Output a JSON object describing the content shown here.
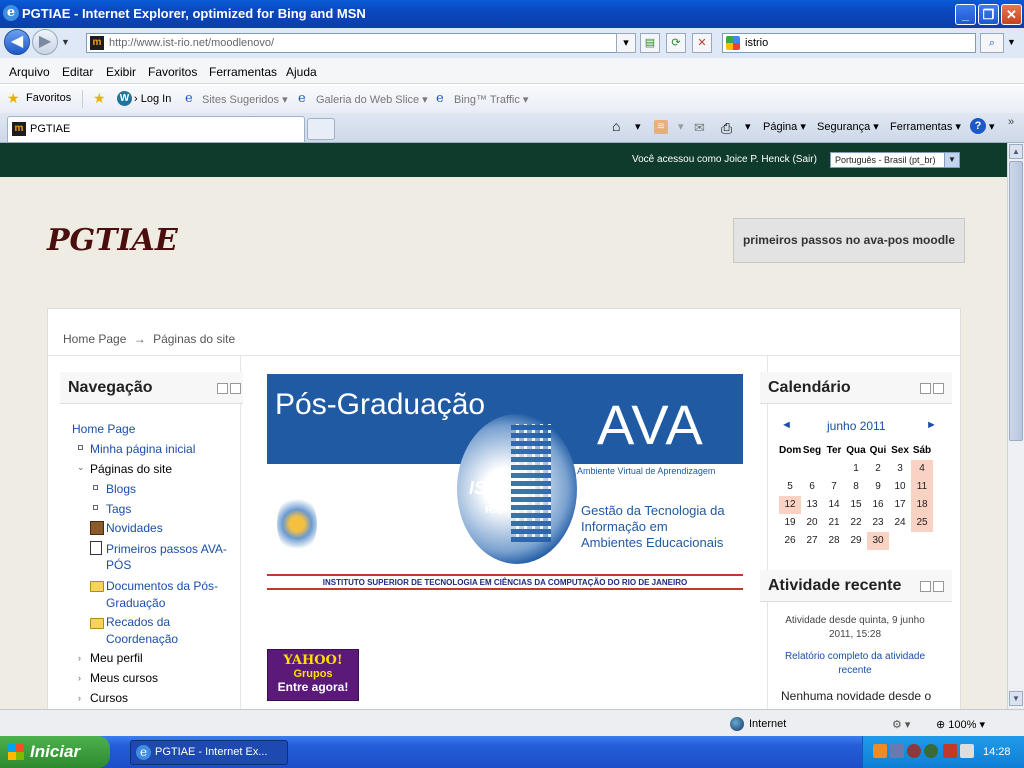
{
  "window": {
    "title": "PGTIAE - Internet Explorer, optimized for Bing and MSN"
  },
  "address": {
    "url": "http://www.ist-rio.net/moodlenovo/",
    "search_value": "istrio"
  },
  "menubar": [
    "Arquivo",
    "Editar",
    "Exibir",
    "Favoritos",
    "Ferramentas",
    "Ajuda"
  ],
  "favbar": {
    "favorites": "Favoritos",
    "login": "Log In",
    "suggested": "Sites Sugeridos",
    "gallery": "Galeria do Web Slice",
    "bing": "Bing™ Traffic"
  },
  "tab": {
    "title": "PGTIAE"
  },
  "commandbar": {
    "page": "Página",
    "security": "Segurança",
    "tools": "Ferramentas"
  },
  "moodle": {
    "logged_in": "Você acessou como Joice P. Henck (Sair)",
    "language": "Português - Brasil (pt_br)",
    "site_name": "PGTIAE",
    "header_button": "primeiros passos no ava-pos moodle",
    "breadcrumb": {
      "home": "Home Page",
      "sep": "→",
      "current": "Páginas do site"
    },
    "navigation": {
      "title": "Navegação",
      "home": "Home Page",
      "my_home": "Minha página inicial",
      "site_pages": "Páginas do site",
      "blogs": "Blogs",
      "tags": "Tags",
      "news": "Novidades",
      "first_steps": "Primeiros passos AVA-PÓS",
      "docs": "Documentos da Pós-Graduação",
      "notes": "Recados da Coordenação",
      "profile": "Meu perfil",
      "my_courses": "Meus cursos",
      "courses": "Cursos"
    },
    "banner": {
      "pos": "Pós-Graduação",
      "ava": "AVA",
      "ava_sub": "Ambiente Virtual de Aprendizagem",
      "ist": "IST",
      "rio": "Rio",
      "gestao": "Gestão da Tecnologia da Informação em Ambientes Educacionais",
      "institute": "INSTITUTO SUPERIOR DE TECNOLOGIA EM CIÊNCIAS DA COMPUTAÇÃO DO RIO DE JANEIRO"
    },
    "yahoo": {
      "brand": "YAHOO!",
      "groups": "Grupos",
      "cta": "Entre agora!"
    },
    "calendar": {
      "title": "Calendário",
      "month": "junho 2011",
      "prev": "◄",
      "next": "►",
      "weekdays": [
        "Dom",
        "Seg",
        "Ter",
        "Qua",
        "Qui",
        "Sex",
        "Sáb"
      ],
      "weeks": [
        [
          "",
          "",
          "",
          "1",
          "2",
          "3",
          "4"
        ],
        [
          "5",
          "6",
          "7",
          "8",
          "9",
          "10",
          "11"
        ],
        [
          "12",
          "13",
          "14",
          "15",
          "16",
          "17",
          "18"
        ],
        [
          "19",
          "20",
          "21",
          "22",
          "23",
          "24",
          "25"
        ],
        [
          "26",
          "27",
          "28",
          "29",
          "30",
          "",
          ""
        ]
      ]
    },
    "recent": {
      "title": "Atividade recente",
      "since": "Atividade desde quinta, 9 junho 2011, 15:28",
      "report": "Relatório completo da atividade recente",
      "none": "Nenhuma novidade desde o"
    }
  },
  "status": {
    "zone": "Internet",
    "zoom": "100%"
  },
  "taskbar": {
    "start": "Iniciar",
    "item": "PGTIAE - Internet Ex...",
    "clock": "14:28"
  }
}
